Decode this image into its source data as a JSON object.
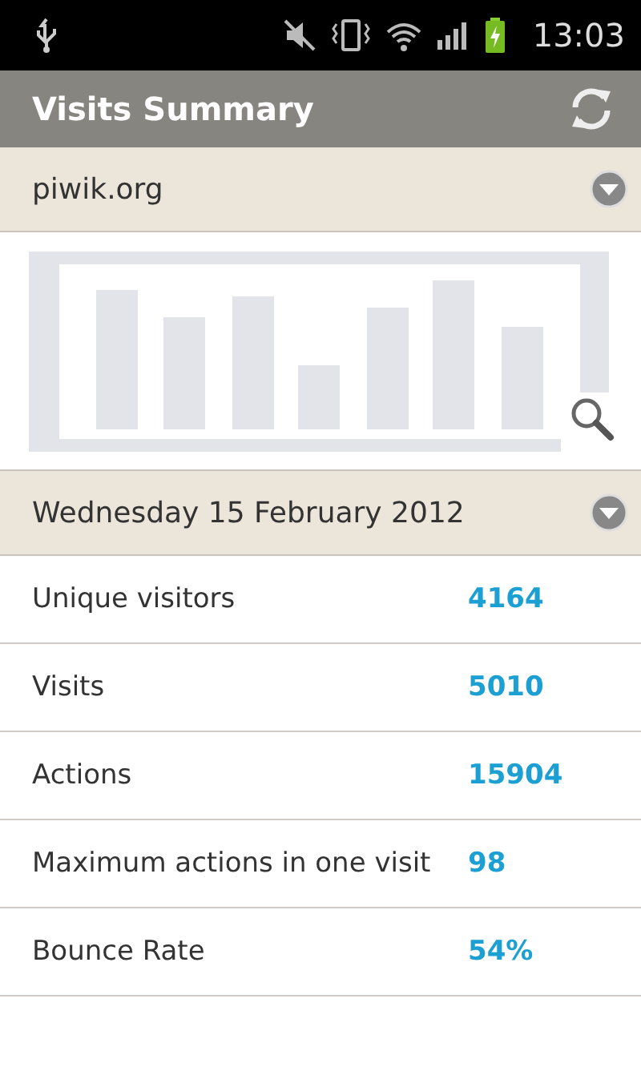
{
  "status_bar": {
    "time": "13:03"
  },
  "title_bar": {
    "title": "Visits Summary"
  },
  "site_selector": {
    "label": "piwik.org"
  },
  "date_selector": {
    "label": "Wednesday 15 February 2012"
  },
  "metrics": [
    {
      "label": "Unique visitors",
      "value": "4164"
    },
    {
      "label": "Visits",
      "value": "5010"
    },
    {
      "label": "Actions",
      "value": "15904"
    },
    {
      "label": "Maximum actions in one visit",
      "value": "98"
    },
    {
      "label": "Bounce Rate",
      "value": "54%"
    }
  ]
}
